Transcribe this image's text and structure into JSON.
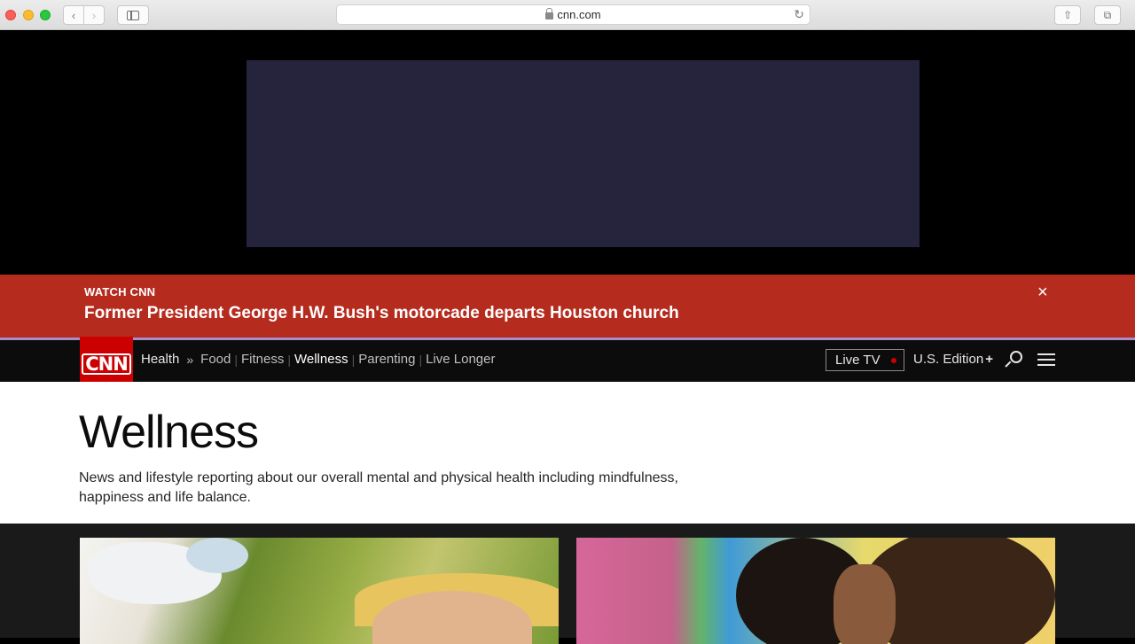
{
  "browser": {
    "url": "cnn.com"
  },
  "breaking": {
    "label": "WATCH CNN",
    "headline": "Former President George H.W. Bush's motorcade departs Houston church",
    "close_icon": "×"
  },
  "nav": {
    "logo": "CNN",
    "section": "Health",
    "chevron": "»",
    "links": [
      "Food",
      "Fitness",
      "Wellness",
      "Parenting",
      "Live Longer"
    ],
    "active_link": "Wellness",
    "live_tv": "Live TV",
    "edition": "U.S. Edition",
    "edition_plus": "+"
  },
  "intro": {
    "title": "Wellness",
    "description": "News and lifestyle reporting about our overall mental and physical health including mindfulness, happiness and life balance."
  },
  "colors": {
    "brand_red": "#cc0000",
    "breaking_red": "#b52c1f",
    "ad_box": "#26243d"
  }
}
